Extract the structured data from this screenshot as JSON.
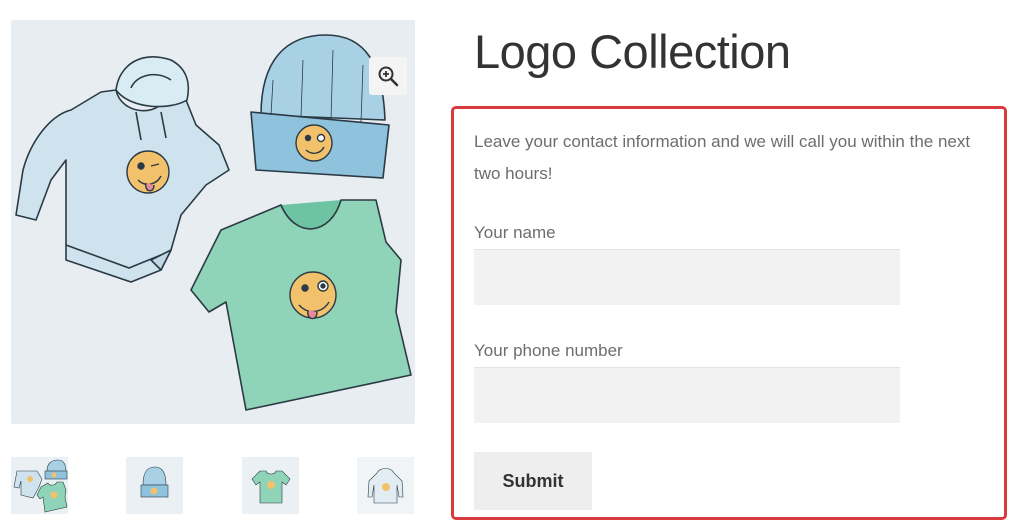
{
  "product": {
    "title": "Logo Collection",
    "image_alt": "Hoodie, beanie and t-shirt with winking emoji logo"
  },
  "gallery": {
    "zoom_icon": "magnifier-plus-icon",
    "thumbnails": [
      "logo-collection",
      "beanie",
      "t-shirt",
      "hoodie"
    ]
  },
  "contact_form": {
    "intro": "Leave your contact information and we will call you within the next two hours!",
    "name_label": "Your name",
    "name_value": "",
    "phone_label": "Your phone number",
    "phone_value": "",
    "submit_label": "Submit",
    "highlight_color": "#d83a3d"
  },
  "colors": {
    "hoodie": "#cfe3ee",
    "beanie": "#8fc2dc",
    "tshirt": "#8fd4b8",
    "emoji": "#f2c16b"
  }
}
